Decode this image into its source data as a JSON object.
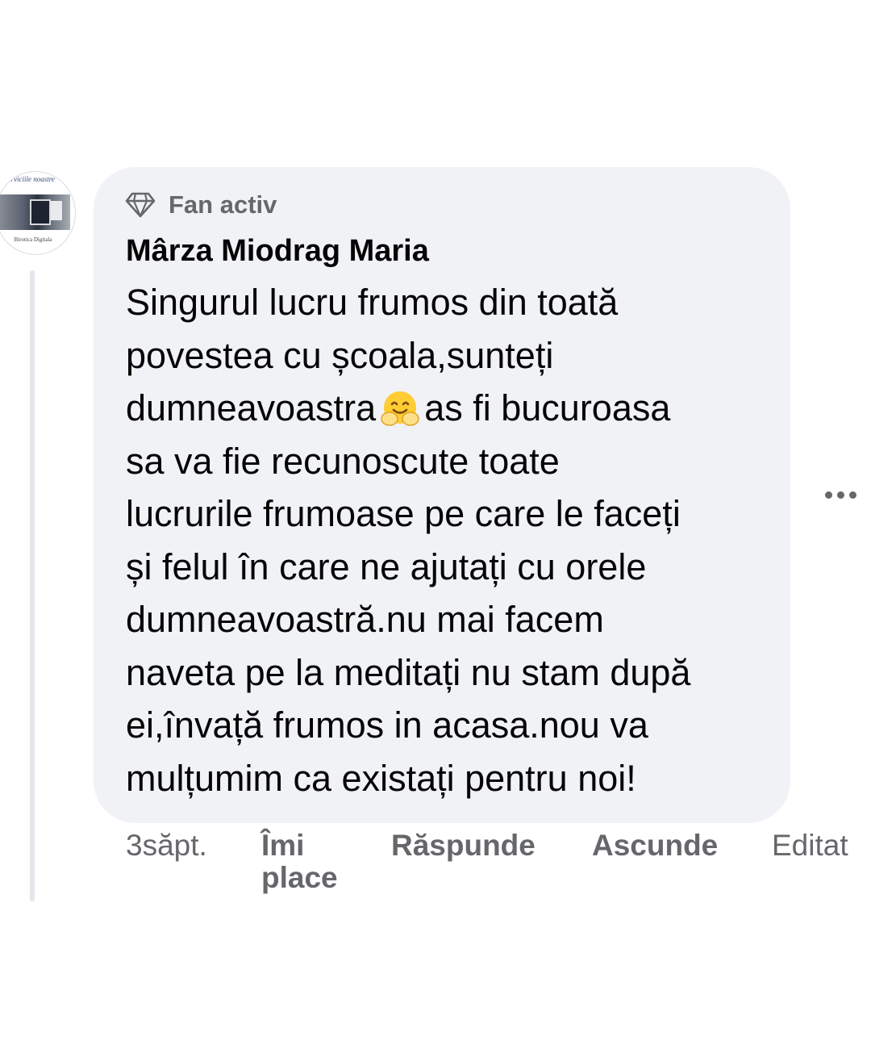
{
  "comment": {
    "avatar": {
      "icon": "page-avatar",
      "ribbon_text": "Serviciile noastre",
      "caption": "Birotica Digitala"
    },
    "badge": {
      "icon": "diamond-icon",
      "label": "Fan activ"
    },
    "author": "Mârza Miodrag Maria",
    "body_lines": [
      "Singurul lucru frumos din toată",
      "povestea cu școala,sunteți",
      "dumneavoastra",
      "as fi bucuroasa",
      "sa va fie recunoscute toate",
      "lucrurile frumoase pe care le faceți",
      "și felul în care ne ajutați cu orele",
      "dumneavoastră.nu mai facem",
      "naveta pe la meditați nu stam după",
      "ei,învață frumos in acasa.nou va",
      "mulțumim ca existați pentru noi!"
    ],
    "emoji": "hugging-face-emoji"
  },
  "actions": {
    "time": "3săpt.",
    "like": "Îmi place",
    "reply": "Răspunde",
    "hide": "Ascunde",
    "edited": "Editat"
  },
  "more_menu": {
    "icon": "more-options-icon"
  },
  "colors": {
    "bubble": "#f0f2f5",
    "text": "#050505",
    "secondary": "#65676b",
    "thread_line": "#e4e6eb"
  }
}
